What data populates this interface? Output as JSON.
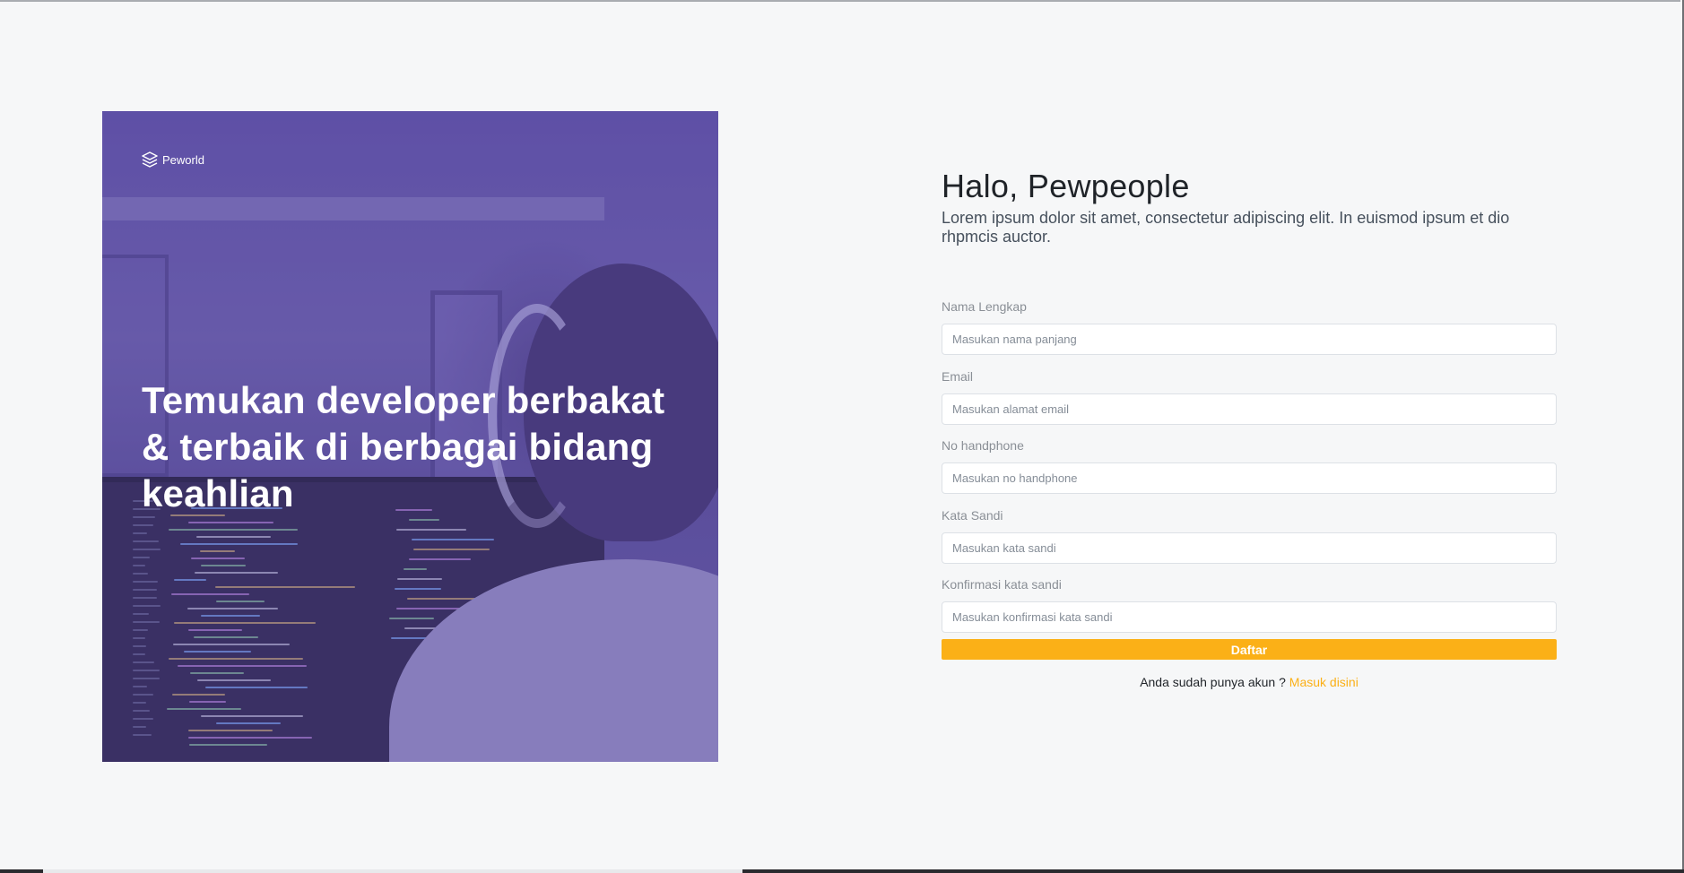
{
  "hero": {
    "brand": "Peworld",
    "headline": "Temukan developer berbakat & terbaik di berbagai bidang keahlian"
  },
  "form": {
    "title": "Halo, Pewpeople",
    "subtitle": "Lorem ipsum dolor sit amet, consectetur adipiscing elit. In euismod ipsum et dio rhpmcis auctor.",
    "fields": [
      {
        "label": "Nama Lengkap",
        "placeholder": "Masukan nama panjang",
        "value": ""
      },
      {
        "label": "Email",
        "placeholder": "Masukan alamat email",
        "value": ""
      },
      {
        "label": "No handphone",
        "placeholder": "Masukan no handphone",
        "value": ""
      },
      {
        "label": "Kata Sandi",
        "placeholder": "Masukan kata sandi",
        "value": ""
      },
      {
        "label": "Konfirmasi kata sandi",
        "placeholder": "Masukan konfirmasi kata sandi",
        "value": ""
      }
    ],
    "submit_label": "Daftar",
    "login_prompt": "Anda sudah punya akun ?",
    "login_link": "Masuk disini"
  },
  "colors": {
    "accent": "#fbb017",
    "hero_overlay": "#5e50aa",
    "background": "#f6f7f8"
  },
  "icons": {
    "brand": "layers-icon"
  }
}
